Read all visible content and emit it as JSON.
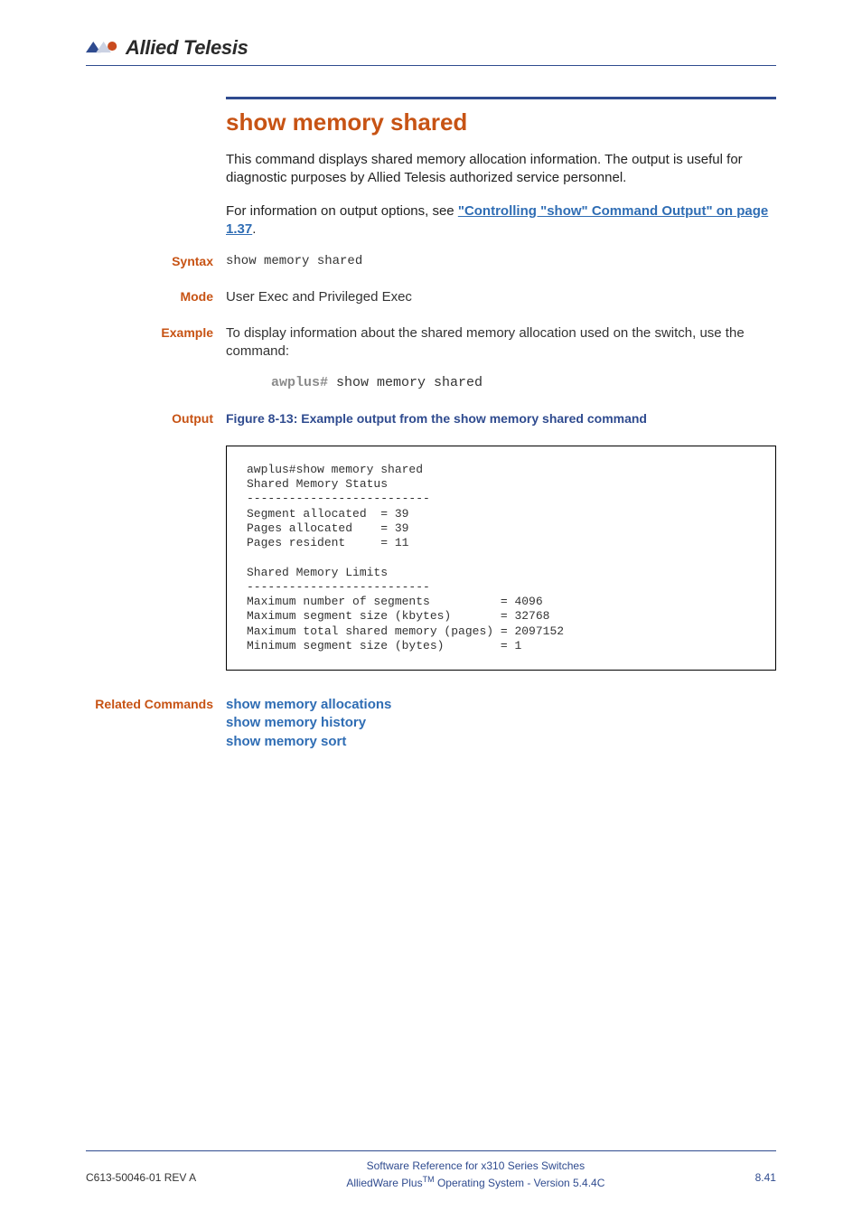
{
  "brand": "Allied Telesis",
  "title": "show memory shared",
  "intro_para": "This command displays shared memory allocation information. The output is useful for diagnostic purposes by Allied Telesis authorized service personnel.",
  "link_intro_prefix": "For information on output options, see ",
  "link_text": "\"Controlling \"show\" Command Output\" on page 1.37",
  "link_suffix": ".",
  "labels": {
    "syntax": "Syntax",
    "mode": "Mode",
    "example": "Example",
    "output": "Output",
    "related": "Related Commands"
  },
  "syntax_value": "show memory shared",
  "mode_value": "User Exec and Privileged Exec",
  "example_text": "To display information about the shared memory allocation used on the switch, use the command:",
  "example_prompt": "awplus#",
  "example_cmd": " show memory shared",
  "output_caption": "Figure 8-13: Example output from the show memory shared command",
  "output_text": "awplus#show memory shared\nShared Memory Status\n--------------------------\nSegment allocated  = 39\nPages allocated    = 39\nPages resident     = 11\n\nShared Memory Limits\n--------------------------\nMaximum number of segments          = 4096\nMaximum segment size (kbytes)       = 32768\nMaximum total shared memory (pages) = 2097152\nMinimum segment size (bytes)        = 1",
  "related_links": {
    "r1": "show memory allocations",
    "r2": "show memory history",
    "r3": "show memory sort"
  },
  "footer": {
    "left": "C613-50046-01 REV A",
    "center_line1": "Software Reference for x310 Series Switches",
    "center_line2_a": "AlliedWare Plus",
    "center_line2_tm": "TM",
    "center_line2_b": " Operating System - Version 5.4.4C",
    "right": "8.41"
  }
}
